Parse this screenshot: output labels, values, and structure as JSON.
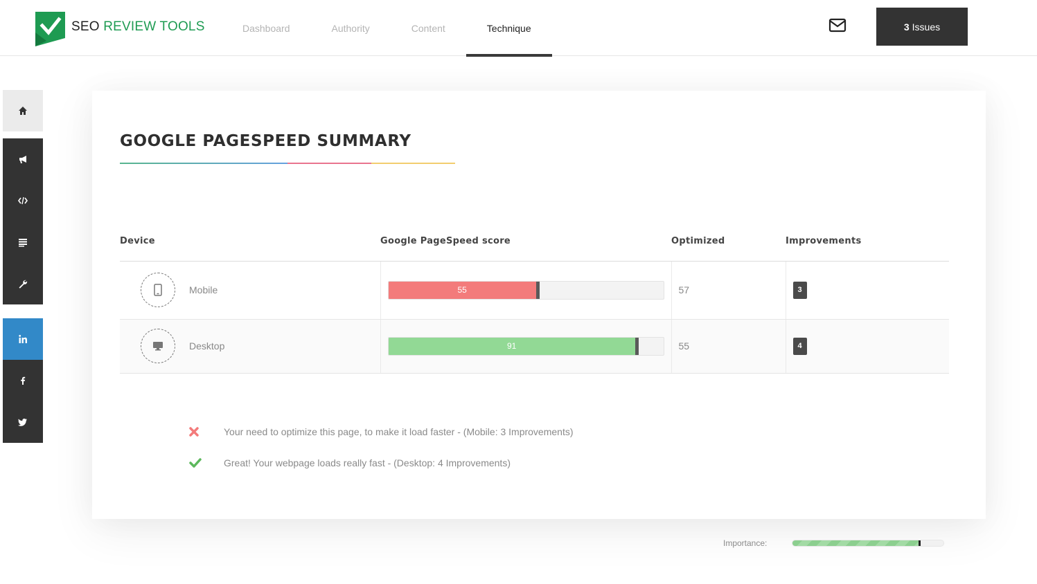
{
  "brand": {
    "prefix": "SEO",
    "accent": "REVIEW TOOLS",
    "green": "#1e9b52"
  },
  "nav": [
    {
      "label": "Dashboard",
      "active": false
    },
    {
      "label": "Authority",
      "active": false
    },
    {
      "label": "Content",
      "active": false
    },
    {
      "label": "Technique",
      "active": true
    }
  ],
  "header": {
    "mail_icon": "envelope-icon",
    "issues_count": "3",
    "issues_label": "Issues"
  },
  "sidebar": [
    {
      "icon": "home-icon"
    },
    {
      "icon": "megaphone-icon"
    },
    {
      "icon": "code-icon"
    },
    {
      "icon": "text-lines-icon"
    },
    {
      "icon": "wrench-icon"
    },
    {
      "icon": "linkedin-icon"
    },
    {
      "icon": "facebook-icon"
    },
    {
      "icon": "twitter-icon"
    }
  ],
  "card": {
    "title": "GOOGLE PAGESPEED SUMMARY",
    "columns": [
      "Device",
      "Google PageSpeed score",
      "Optimized",
      "Improvements"
    ],
    "rows": [
      {
        "device": "Mobile",
        "icon": "mobile-phone-icon",
        "score": "55",
        "score_pct": 55,
        "optimized": "57",
        "improvements": "3",
        "bar_color": "#f37b7b"
      },
      {
        "device": "Desktop",
        "icon": "desktop-monitor-icon",
        "score": "91",
        "score_pct": 91,
        "optimized": "55",
        "improvements": "4",
        "bar_color": "#92d995"
      }
    ],
    "messages": [
      {
        "status": "fail",
        "icon": "cross-icon",
        "text": "Your need to optimize this page, to make it load faster - (Mobile: 3 Improvements)"
      },
      {
        "status": "pass",
        "icon": "checkmark-icon",
        "text": "Great! Your webpage loads really fast - (Desktop: 4 Improvements)"
      }
    ]
  },
  "importance": {
    "label": "Importance:",
    "level_pct": 85
  },
  "colors": {
    "dark": "#333333",
    "linkedin": "#3289c8",
    "fail": "#f37b7b",
    "pass": "#5cb85c"
  }
}
